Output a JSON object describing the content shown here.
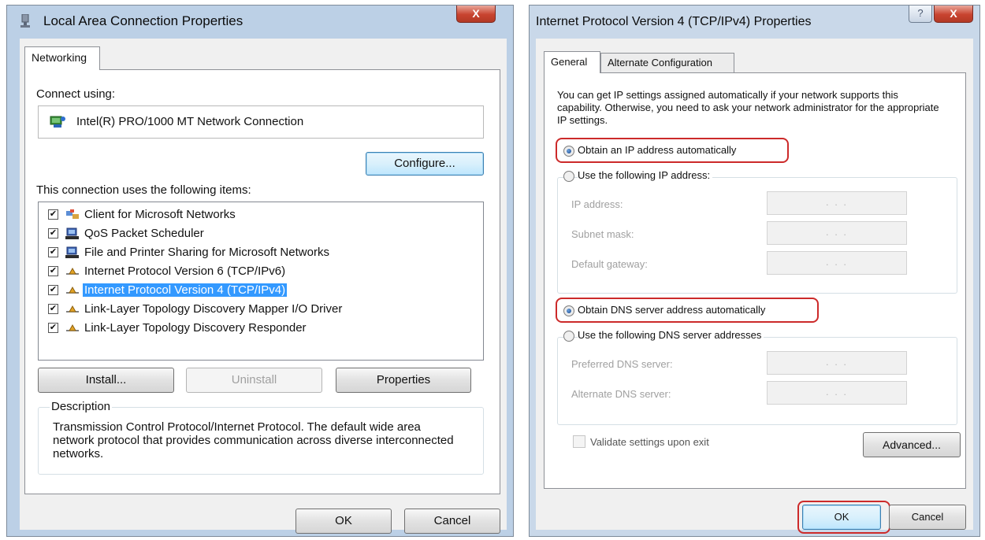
{
  "left_dialog": {
    "title": "Local Area Connection Properties",
    "close_glyph": "X",
    "tab": "Networking",
    "connect_using_label": "Connect using:",
    "adapter_name": "Intel(R) PRO/1000 MT Network Connection",
    "configure_button": "Configure...",
    "items_label": "This connection uses the following items:",
    "items": [
      {
        "label": "Client for Microsoft Networks",
        "checked": true,
        "icon": "network-client-icon"
      },
      {
        "label": "QoS Packet Scheduler",
        "checked": true,
        "icon": "service-icon"
      },
      {
        "label": "File and Printer Sharing for Microsoft Networks",
        "checked": true,
        "icon": "service-icon"
      },
      {
        "label": "Internet Protocol Version 6 (TCP/IPv6)",
        "checked": true,
        "icon": "protocol-icon"
      },
      {
        "label": "Internet Protocol Version 4 (TCP/IPv4)",
        "checked": true,
        "icon": "protocol-icon",
        "selected": true
      },
      {
        "label": "Link-Layer Topology Discovery Mapper I/O Driver",
        "checked": true,
        "icon": "protocol-icon"
      },
      {
        "label": "Link-Layer Topology Discovery Responder",
        "checked": true,
        "icon": "protocol-icon"
      }
    ],
    "check_glyph": "✔",
    "install_button": "Install...",
    "uninstall_button": "Uninstall",
    "properties_button": "Properties",
    "description_label": "Description",
    "description_text": "Transmission Control Protocol/Internet Protocol. The default wide area network protocol that provides communication across diverse interconnected networks.",
    "ok_button": "OK",
    "cancel_button": "Cancel"
  },
  "right_dialog": {
    "title": "Internet Protocol Version 4 (TCP/IPv4) Properties",
    "help_glyph": "?",
    "close_glyph": "X",
    "tabs": [
      "General",
      "Alternate Configuration"
    ],
    "intro_text": "You can get IP settings assigned automatically if your network supports this capability. Otherwise, you need to ask your network administrator for the appropriate IP settings.",
    "obtain_ip_auto": "Obtain an IP address automatically",
    "use_following_ip": "Use the following IP address:",
    "ip_address_label": "IP address:",
    "subnet_mask_label": "Subnet mask:",
    "default_gateway_label": "Default gateway:",
    "empty_ip_value": ". . .",
    "obtain_dns_auto": "Obtain DNS server address automatically",
    "use_following_dns": "Use the following DNS server addresses",
    "preferred_dns_label": "Preferred DNS server:",
    "alternate_dns_label": "Alternate DNS server:",
    "validate_label": "Validate settings upon exit",
    "advanced_button": "Advanced...",
    "ok_button": "OK",
    "cancel_button": "Cancel"
  },
  "colors": {
    "selection": "#3399ff",
    "highlight_outline": "#cc2a2a",
    "close_button": "#c8432f"
  }
}
